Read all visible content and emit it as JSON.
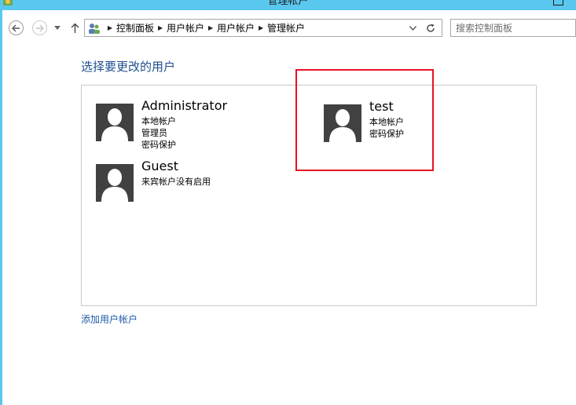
{
  "window": {
    "title": "管理帐户"
  },
  "address_bar": {
    "breadcrumbs": [
      "控制面板",
      "用户帐户",
      "用户帐户",
      "管理帐户"
    ]
  },
  "search": {
    "placeholder": "搜索控制面板"
  },
  "main": {
    "title": "选择要更改的用户",
    "users": [
      {
        "name": "Administrator",
        "details": [
          "本地帐户",
          "管理员",
          "密码保护"
        ]
      },
      {
        "name": "test",
        "details": [
          "本地帐户",
          "密码保护"
        ]
      },
      {
        "name": "Guest",
        "details": [
          "来宾帐户没有启用"
        ]
      }
    ],
    "add_account_link": "添加用户帐户"
  },
  "colors": {
    "title_bar": "#5ac8ee",
    "link": "#1e5aa8",
    "heading": "#1e4e8c",
    "avatar_bg": "#414141",
    "highlight": "#e81123"
  }
}
